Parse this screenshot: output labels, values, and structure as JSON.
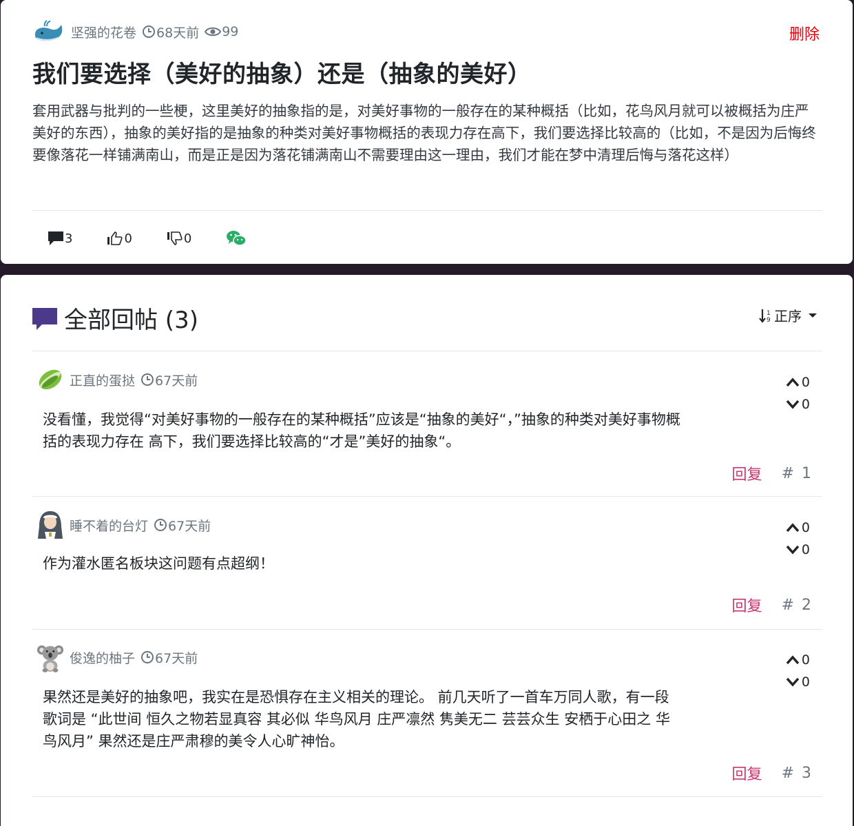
{
  "post": {
    "author": "坚强的花卷",
    "time": "68天前",
    "views": "99",
    "delete_label": "删除",
    "title": "我们要选择（美好的抽象）还是（抽象的美好）",
    "body": "套用武器与批判的一些梗，这里美好的抽象指的是，对美好事物的一般存在的某种概括（比如，花鸟风月就可以被概括为庄严美好的东西），抽象的美好指的是抽象的种类对美好事物概括的表现力存在高下，我们要选择比较高的（比如，不是因为后悔终要像落花一样铺满南山，而是正是因为落花铺满南山不需要理由这一理由，我们才能在梦中清理后悔与落花这样）",
    "actions": {
      "comments": "3",
      "likes": "0",
      "dislikes": "0"
    }
  },
  "replies_section": {
    "title": "全部回帖 (3)",
    "sort_label": "正序"
  },
  "replies": [
    {
      "author": "正直的蛋挞",
      "time": "67天前",
      "body": "没看懂，我觉得“对美好事物的一般存在的某种概括”应该是“抽象的美好“，”抽象的种类对美好事物概括的表现力存在 高下，我们要选择比较高的“才是”美好的抽象“。",
      "up": "0",
      "down": "0",
      "reply_label": "回复",
      "floor": "# 1"
    },
    {
      "author": "睡不着的台灯",
      "time": "67天前",
      "body": "作为灌水匿名板块这问题有点超纲！",
      "up": "0",
      "down": "0",
      "reply_label": "回复",
      "floor": "# 2"
    },
    {
      "author": "俊逸的柚子",
      "time": "67天前",
      "body": "果然还是美好的抽象吧，我实在是恐惧存在主义相关的理论。 前几天听了一首车万同人歌，有一段歌词是 “此世间 恒久之物若显真容 其必似 华鸟风月 庄严凛然 隽美无二 芸芸众生 安栖于心田之 华鸟风月” 果然还是庄严肃穆的美令人心旷神怡。",
      "up": "0",
      "down": "0",
      "reply_label": "回复",
      "floor": "# 3"
    }
  ],
  "colors": {
    "background": "#241a2a",
    "delete": "#e3000f",
    "reply_link": "#c9386e",
    "section_icon": "#4b3a8c",
    "wechat": "#2aae67"
  },
  "icons": [
    "whale-avatar",
    "clock-icon",
    "eye-icon",
    "comment-icon",
    "thumbs-up-icon",
    "thumbs-down-icon",
    "wechat-icon",
    "chat-bubble-icon",
    "sort-icon",
    "arrow-up-icon",
    "arrow-down-icon"
  ]
}
